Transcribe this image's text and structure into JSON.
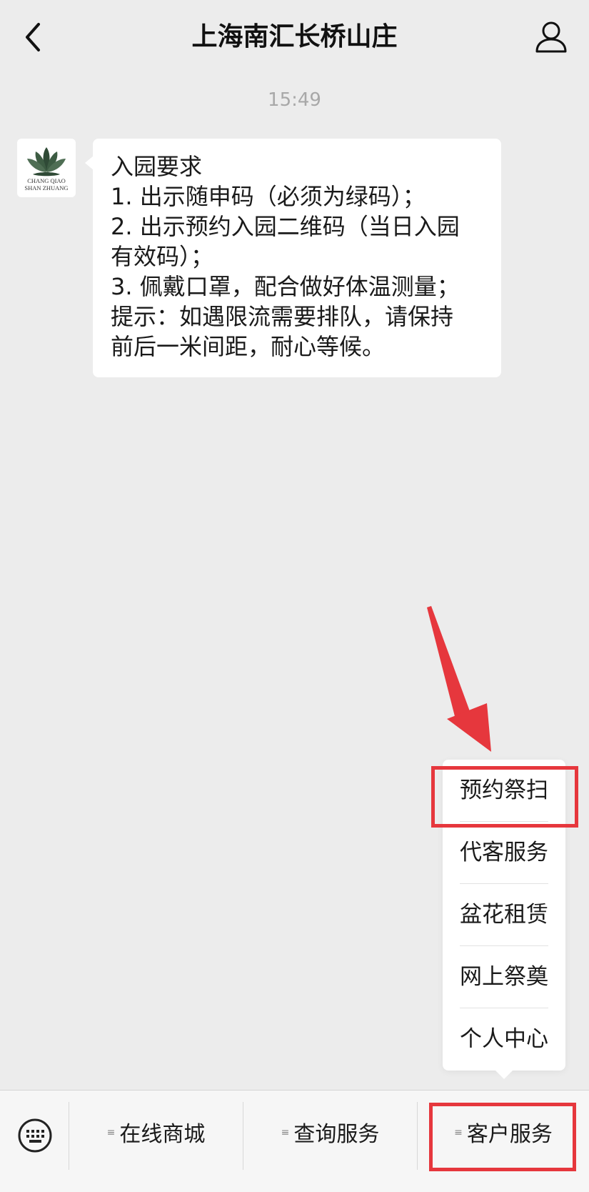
{
  "header": {
    "title": "上海南汇长桥山庄"
  },
  "chat": {
    "timestamp": "15:49",
    "avatar_caption": [
      "CHANG QIAO",
      "SHAN ZHUANG"
    ],
    "message_lines": [
      "入园要求",
      "1. 出示随申码（必须为绿码）；",
      "2. 出示预约入园二维码（当日入园",
      "有效码）；",
      "3. 佩戴口罩，配合做好体温测量；",
      "提示：如遇限流需要排队，请保持",
      "前后一米间距，耐心等候。"
    ]
  },
  "popup_menu": {
    "items": [
      {
        "label": "预约祭扫"
      },
      {
        "label": "代客服务"
      },
      {
        "label": "盆花租赁"
      },
      {
        "label": "网上祭奠"
      },
      {
        "label": "个人中心"
      }
    ]
  },
  "bottom_menu": {
    "items": [
      {
        "label": "在线商城"
      },
      {
        "label": "查询服务"
      },
      {
        "label": "客户服务"
      }
    ],
    "menu_mark": "≡"
  },
  "colors": {
    "background": "#ececec",
    "bubble": "#ffffff",
    "highlight": "#e6373d",
    "timestamp": "#a8a8a8"
  }
}
